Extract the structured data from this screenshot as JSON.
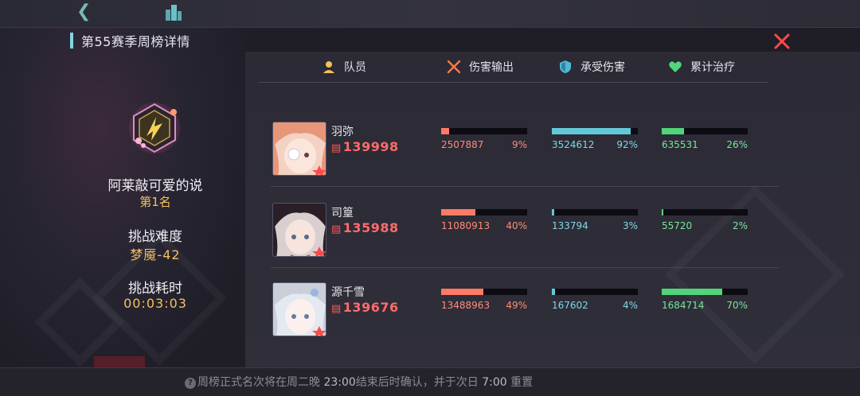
{
  "title": "第55赛季周榜详情",
  "player": {
    "name": "阿莱敲可爱的说",
    "rank": "第1名"
  },
  "difficulty": {
    "label": "挑战难度",
    "value": "梦魇-42"
  },
  "time": {
    "label": "挑战耗时",
    "value": "00:03:03"
  },
  "headers": {
    "member": "队员",
    "damage": "伤害输出",
    "taken": "承受伤害",
    "heal": "累计治疗"
  },
  "members": [
    {
      "name": "羽弥",
      "power": "139998",
      "damage": {
        "value": "2507887",
        "pct_label": "9%",
        "pct": 9
      },
      "taken": {
        "value": "3524612",
        "pct_label": "92%",
        "pct": 92
      },
      "heal": {
        "value": "635531",
        "pct_label": "26%",
        "pct": 26
      }
    },
    {
      "name": "司篁",
      "power": "135988",
      "damage": {
        "value": "11080913",
        "pct_label": "40%",
        "pct": 40
      },
      "taken": {
        "value": "133794",
        "pct_label": "3%",
        "pct": 3
      },
      "heal": {
        "value": "55720",
        "pct_label": "2%",
        "pct": 2
      }
    },
    {
      "name": "源千雪",
      "power": "139676",
      "damage": {
        "value": "13488963",
        "pct_label": "49%",
        "pct": 49
      },
      "taken": {
        "value": "167602",
        "pct_label": "4%",
        "pct": 4
      },
      "heal": {
        "value": "1684714",
        "pct_label": "70%",
        "pct": 70
      }
    }
  ],
  "notice": {
    "prefix": "周榜正式名次将在周二晚",
    "t1": "23:00",
    "mid": "结束后时确认，并于次日",
    "t2": "7:00",
    "suffix": "重置"
  },
  "colors": {
    "damage": "#ff7a66",
    "taken": "#62c8d8",
    "heal": "#52d47a",
    "rank": "#f4c060",
    "power": "#ff6b6b"
  },
  "icons": {
    "back": "back-chevron-icon",
    "city": "city-icon",
    "close": "close-x-icon",
    "member": "member-icon",
    "damage": "crossed-swords-icon",
    "taken": "shield-icon",
    "heal": "heart-icon"
  }
}
